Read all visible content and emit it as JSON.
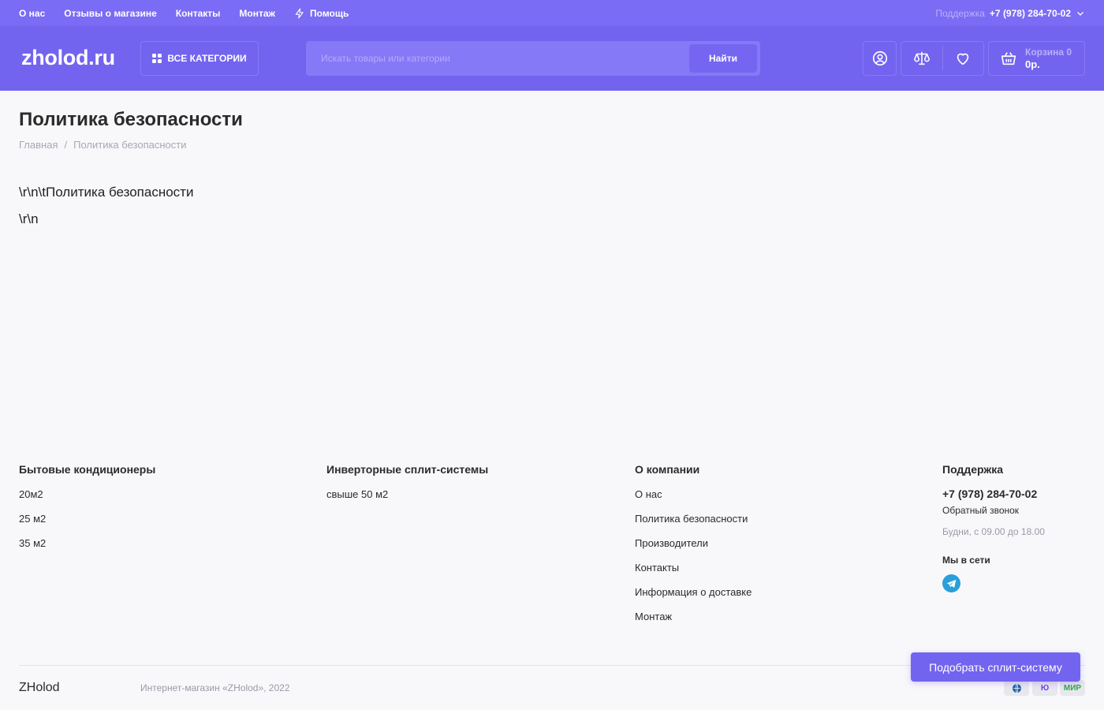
{
  "topbar": {
    "nav": [
      "О нас",
      "Отзывы о магазине",
      "Контакты",
      "Монтаж"
    ],
    "help_label": "Помощь",
    "help_icon": "lightning-icon",
    "support_label": "Поддержка",
    "support_phone": "+7 (978) 284-70-02"
  },
  "header": {
    "logo": "zholod.ru",
    "categories_label": "ВСЕ КАТЕГОРИИ",
    "search_placeholder": "Искать товары или категории",
    "search_button": "Найти",
    "icons": [
      "user-icon",
      "compare-scales-icon",
      "heart-icon",
      "basket-icon"
    ],
    "cart_label": "Корзина 0",
    "cart_total": "0р."
  },
  "main": {
    "title": "Политика безопасности",
    "breadcrumb": [
      "Главная",
      "/",
      "Политика безопасности"
    ],
    "content": [
      "\\r\\n\\tПолитика безопасности",
      "\\r\\n"
    ]
  },
  "footer": {
    "col1": {
      "title": "Бытовые кондиционеры",
      "items": [
        "20м2",
        "25 м2",
        "35 м2"
      ]
    },
    "col2": {
      "title": "Инверторные сплит-системы",
      "items": [
        "свыше 50 м2"
      ]
    },
    "col3": {
      "title": "О компании",
      "items": [
        "О нас",
        "Политика безопасности",
        "Производители",
        "Контакты",
        "Информация о доставке",
        "Монтаж"
      ]
    },
    "support": {
      "title": "Поддержка",
      "phone": "+7 (978) 284-70-02",
      "callback": "Обратный звонок",
      "hours": "Будни, с 09.00 до 18.00",
      "social_label": "Мы в сети",
      "social_icon": "telegram-icon"
    },
    "brand": "ZHolod",
    "copyright": "Интернет-магазин «ZHolod», 2022",
    "payments": [
      "visa-icon",
      "yoomoney-icon",
      "mir-icon"
    ],
    "payment_texts": [
      "",
      "Ю",
      "МИР"
    ],
    "cta": "Подобрать сплит-систему"
  },
  "colors": {
    "brand": "#7364f0",
    "topbar": "#7a6cf4",
    "telegram": "#2a9fd8"
  }
}
